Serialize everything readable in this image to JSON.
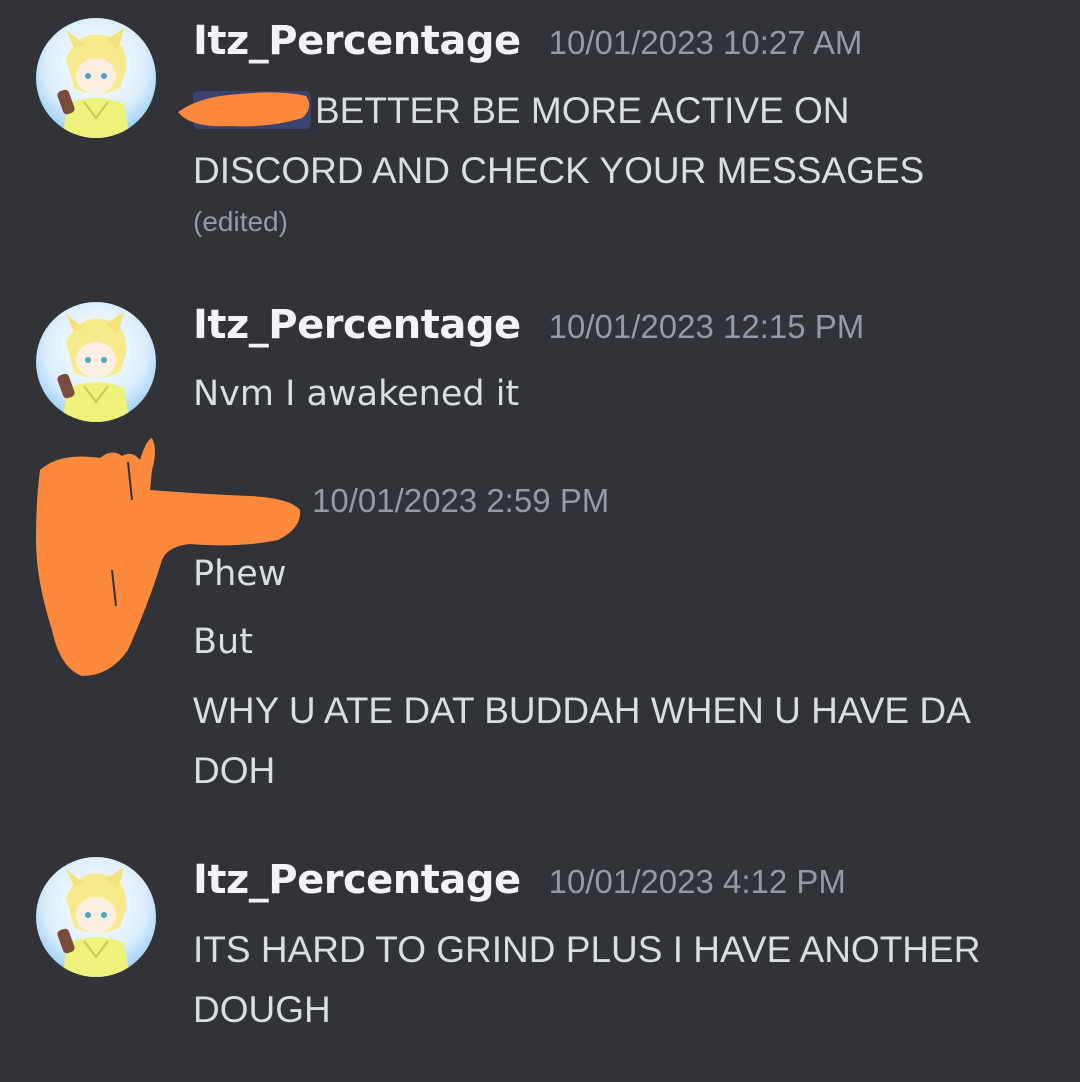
{
  "colors": {
    "background": "#313338",
    "username": "#f2f3f5",
    "text": "#dbdee1",
    "timestamp": "#949ba4",
    "mention_bg": "#3c4270",
    "redaction": "#fd8a3c"
  },
  "messages": [
    {
      "author": "Itz_Percentage",
      "timestamp": "10/01/2023 10:27 AM",
      "lines": [
        "BETTER BE MORE ACTIVE ON",
        "DISCORD AND CHECK YOUR MESSAGES"
      ],
      "edited": "(edited)"
    },
    {
      "author": "Itz_Percentage",
      "timestamp": "10/01/2023 12:15 PM",
      "lines": [
        "Nvm I awakened it"
      ]
    },
    {
      "author": "",
      "timestamp": "10/01/2023 2:59 PM",
      "lines": [
        "Phew",
        "But",
        "WHY U ATE DAT BUDDAH WHEN U HAVE DA",
        "DOH"
      ]
    },
    {
      "author": "Itz_Percentage",
      "timestamp": "10/01/2023 4:12 PM",
      "lines": [
        "ITS HARD TO GRIND PLUS I HAVE ANOTHER",
        "DOUGH"
      ]
    }
  ]
}
